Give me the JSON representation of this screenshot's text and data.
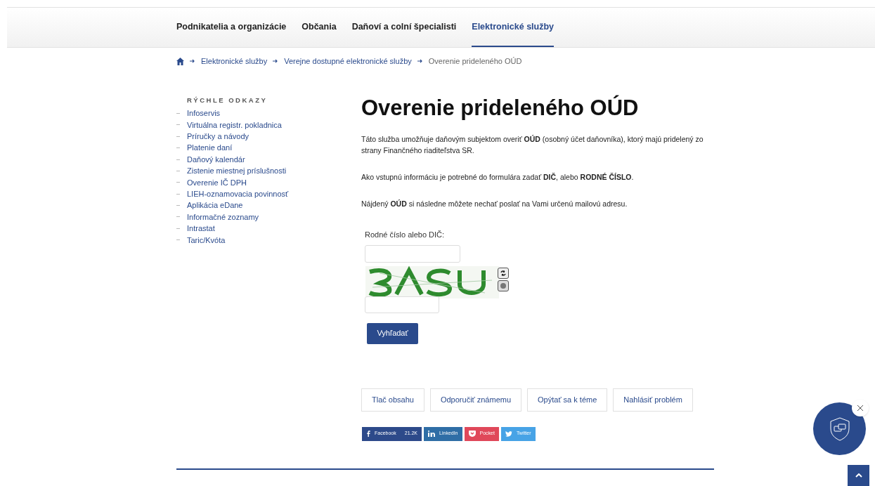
{
  "nav": [
    {
      "label": "Podnikatelia a organizácie",
      "selected": false
    },
    {
      "label": "Občania",
      "selected": false
    },
    {
      "label": "Daňoví a colní špecialisti",
      "selected": false
    },
    {
      "label": "Elektronické služby",
      "selected": true
    }
  ],
  "breadcrumb": [
    {
      "label": "Elektronické služby",
      "kind": "link"
    },
    {
      "label": "Verejne dostupné elektronické služby",
      "kind": "link"
    },
    {
      "label": "Overenie prideleného OÚD",
      "kind": "current"
    }
  ],
  "sidebar": {
    "title": "RÝCHLE ODKAZY",
    "items": [
      "Infoservis",
      "Virtuálna registr. pokladnica",
      "Príručky a návody",
      "Platenie daní",
      "Daňový kalendár",
      "Zistenie miestnej príslušnosti",
      "Overenie IČ DPH",
      "LIEH-oznamovacia povinnosť",
      "Aplikácia eDane",
      "Informačné zoznamy",
      "Intrastat",
      "Taric/Kvóta"
    ]
  },
  "main": {
    "title": "Overenie prideleného OÚD",
    "paragraphs": [
      "Táto služba umožňuje daňovým subjektom overiť  **OÚD** (osobný účet daňovníka), ktorý majú pridelený zo strany Finančného riaditeľstva SR.",
      "Ako vstupnú informáciu je potrebné do formulára zadať **DIČ**, alebo **RODNÉ ČÍSLO**.",
      "Nájdený **OÚD** si následne môžete nechať poslať na Vami určenú mailovú adresu."
    ],
    "form": {
      "label": "Rodné číslo alebo DIČ:",
      "submit": "Vyhľadať"
    },
    "actions": [
      "Tlač obsahu",
      "Odporučiť známemu",
      "Opýtať sa k téme",
      "Nahlásiť problém"
    ],
    "share": [
      {
        "kind": "facebook",
        "label": "Facebook",
        "count": "21.2K",
        "color": "#2d4a8a"
      },
      {
        "kind": "linkedin",
        "label": "LinkedIn",
        "color": "#2f6ea6"
      },
      {
        "kind": "pocket",
        "label": "Pocket",
        "color": "#e0485a"
      },
      {
        "kind": "twitter",
        "label": "Twitter",
        "color": "#47a3e6"
      }
    ]
  }
}
